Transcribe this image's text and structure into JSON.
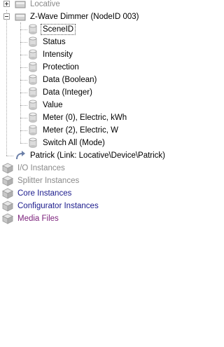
{
  "tree": {
    "locative": {
      "label": "Locative",
      "expander": "plus",
      "icon": "device-folder-icon"
    },
    "zwave": {
      "label": "Z-Wave Dimmer (NodeID 003)",
      "expander": "minus",
      "icon": "device-folder-icon",
      "children": [
        {
          "label": "SceneID",
          "icon": "cylinder-icon",
          "selected": true
        },
        {
          "label": "Status",
          "icon": "cylinder-icon"
        },
        {
          "label": "Intensity",
          "icon": "cylinder-icon"
        },
        {
          "label": "Protection",
          "icon": "cylinder-icon"
        },
        {
          "label": "Data (Boolean)",
          "icon": "cylinder-icon"
        },
        {
          "label": "Data (Integer)",
          "icon": "cylinder-icon"
        },
        {
          "label": "Value",
          "icon": "cylinder-icon"
        },
        {
          "label": "Meter (0), Electric, kWh",
          "icon": "cylinder-icon"
        },
        {
          "label": "Meter (2), Electric, W",
          "icon": "cylinder-icon"
        },
        {
          "label": "Switch All (Mode)",
          "icon": "cylinder-icon"
        }
      ]
    },
    "link": {
      "label": "Patrick (Link: Locative\\Device\\Patrick)",
      "icon": "link-arrow-icon"
    },
    "roots": [
      {
        "label": "I/O Instances",
        "style": "gray",
        "icon": "cube-icon"
      },
      {
        "label": "Splitter Instances",
        "style": "gray",
        "icon": "cube-icon"
      },
      {
        "label": "Core Instances",
        "style": "blue",
        "icon": "cube-icon"
      },
      {
        "label": "Configurator Instances",
        "style": "blue",
        "icon": "cube-icon"
      },
      {
        "label": "Media Files",
        "style": "purple",
        "icon": "cube-icon"
      }
    ]
  },
  "colors": {
    "gray_text": "#8a8a8a",
    "blue_text": "#1a1a8c",
    "purple_text": "#7a1f7a",
    "tree_line": "#a8a8a8"
  }
}
